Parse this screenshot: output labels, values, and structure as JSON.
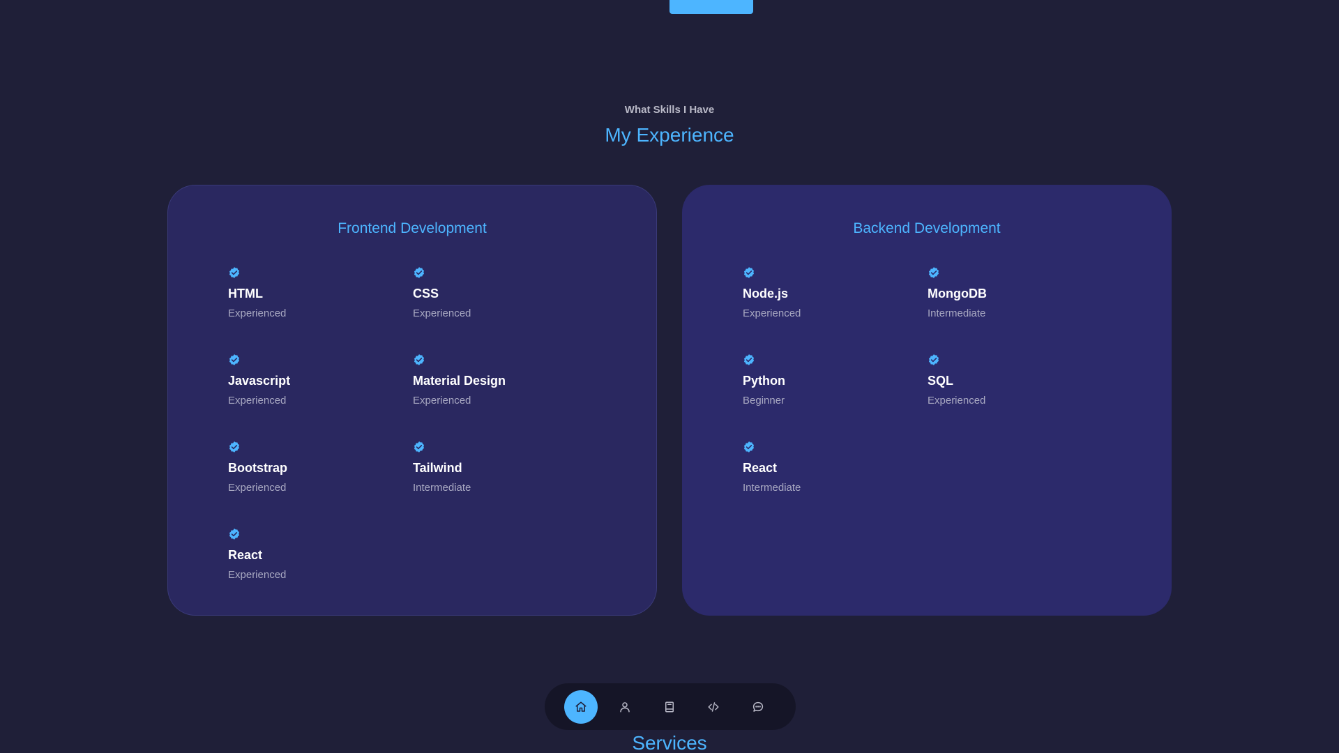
{
  "header": {
    "subtitle": "What Skills I Have",
    "title": "My Experience"
  },
  "frontend": {
    "title": "Frontend Development",
    "skills": [
      {
        "name": "HTML",
        "level": "Experienced"
      },
      {
        "name": "CSS",
        "level": "Experienced"
      },
      {
        "name": "Javascript",
        "level": "Experienced"
      },
      {
        "name": "Material Design",
        "level": "Experienced"
      },
      {
        "name": "Bootstrap",
        "level": "Experienced"
      },
      {
        "name": "Tailwind",
        "level": "Intermediate"
      },
      {
        "name": "React",
        "level": "Experienced"
      }
    ]
  },
  "backend": {
    "title": "Backend Development",
    "skills": [
      {
        "name": "Node.js",
        "level": "Experienced"
      },
      {
        "name": "MongoDB",
        "level": "Intermediate"
      },
      {
        "name": "Python",
        "level": "Beginner"
      },
      {
        "name": "SQL",
        "level": "Experienced"
      },
      {
        "name": "React",
        "level": "Intermediate"
      }
    ]
  },
  "nav": {
    "items": [
      {
        "icon": "home-icon",
        "active": true
      },
      {
        "icon": "user-icon",
        "active": false
      },
      {
        "icon": "book-icon",
        "active": false
      },
      {
        "icon": "code-icon",
        "active": false
      },
      {
        "icon": "message-icon",
        "active": false
      }
    ]
  },
  "next_section": {
    "title": "Services"
  },
  "colors": {
    "accent": "#4db5ff",
    "background": "#1f1f38",
    "card": "#2c2a6b"
  }
}
